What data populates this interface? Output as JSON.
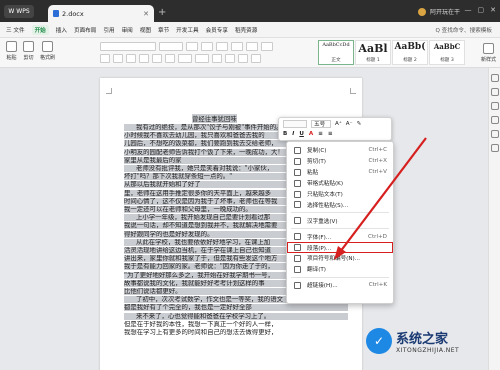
{
  "titlebar": {
    "wps_label": "WPS",
    "doc_tab": "2.docx",
    "user": "阿开玩在干"
  },
  "menu": {
    "items": [
      "三 文件",
      "开始",
      "插入",
      "页面布局",
      "引用",
      "审阅",
      "视图",
      "章节",
      "开发工具",
      "会员专享",
      "稻壳资源"
    ],
    "active_index": 1,
    "search": "Q 查找命令、搜索模板"
  },
  "ribbon": {
    "paste": "粘贴",
    "cut": "剪切",
    "format_painter": "格式刷",
    "styles": [
      {
        "sample": "AaBbCcDd",
        "label": "正文"
      },
      {
        "sample": "AaBl",
        "label": "标题 1"
      },
      {
        "sample": "AaBb(",
        "label": "标题 2"
      },
      {
        "sample": "AaBbC",
        "label": "标题 3"
      }
    ],
    "new_style": "新样式"
  },
  "document": {
    "title": "曾经往事犹回味",
    "lines": [
      "我有过的绝技，是从那次\"饺子与刚被\"事件开始的。",
      "小时候我不喜欢去幼儿园，我只喜欢和爸爸去我的",
      "儿园后，不想吃的饭菜都，我们要跑到我去交给老师，",
      "小明友的园配老师告诉我打个饭了下来，一晚成功，大！",
      "家里从是我最后的家",
      "老师没有批评我，她只是笑着对我说：\"小家伙，",
      "坏打\"吗？那下次我就穿条短一点的。\"",
      "从那以后我就开始和了好了",
      "里，老师在这用手推定很多你的天平面上，越来越多",
      "时间心情了，这不仅是因为我于了坏事，老师也在等我",
      "我一定还可以在老师和父母里，一晚成功的。",
      "上小学一年级，我开始发现自己是要计划看过那",
      "我说一句话，却不知道是想到我并不，我就解决地需要",
      "得好跟同学的也是好好发现的。",
      "从此在学校，我也要依依好好地学习，在课上加",
      "活灵活现地讲给这边当机，在于学在课上自己也知道",
      "讲出来，家里你就和我家了于，但是我有些发这个地方",
      "我于是有能力回家的家。老师说：\"因为你走了于的，",
      "\"为了更好地好那么多之，我开始在好我学期书一号，",
      "故事都说我的文化，我就能好好考考计划这样的事",
      "比他们说话都更好。",
      "了初中，次次考试数学，作文也是一等奖，我的语文",
      "都是我好有了个完全的，我也是一定好好全部",
      "来不来了，心也觉得能和爸爸在学校学习上了。",
      "但是在于好我的本性，我想一下真正一个好的人一样，",
      "我想在学习上有更多的时间和自己的想法去做得更好，"
    ]
  },
  "float_toolbar": {
    "size": "五号",
    "buttons": [
      "B",
      "I",
      "U",
      "A",
      "≡",
      "≡"
    ]
  },
  "context_menu": {
    "items": [
      {
        "label": "复制(C)",
        "shortcut": "Ctrl+C",
        "icon": "copy-icon"
      },
      {
        "label": "剪切(T)",
        "shortcut": "Ctrl+X",
        "icon": "scissors-icon"
      },
      {
        "label": "粘贴",
        "shortcut": "Ctrl+V",
        "icon": "paste-icon"
      },
      {
        "label": "带格式粘贴(K)",
        "shortcut": "",
        "icon": "paste-format-icon"
      },
      {
        "label": "只粘贴文本(T)",
        "shortcut": "",
        "icon": "paste-text-icon"
      },
      {
        "label": "选择性粘贴(S)...",
        "shortcut": "",
        "icon": "paste-special-icon"
      },
      {
        "label": "汉字重选(V)",
        "shortcut": "",
        "icon": "hanzi-icon"
      },
      {
        "label": "字体(F)...",
        "shortcut": "Ctrl+D",
        "icon": "font-icon"
      },
      {
        "label": "段落(P)...",
        "shortcut": "",
        "icon": "paragraph-icon"
      },
      {
        "label": "项目符号和编号(N)...",
        "shortcut": "",
        "icon": "list-icon"
      },
      {
        "label": "翻译(T)",
        "shortcut": "",
        "icon": "translate-icon"
      },
      {
        "label": "超链接(H)...",
        "shortcut": "Ctrl+K",
        "icon": "link-icon"
      }
    ],
    "highlighted_index": 8
  },
  "watermark": {
    "name": "系统之家",
    "url": "XITONGZHIJIA.NET"
  },
  "colors": {
    "accent": "#1e8c4a",
    "highlight_box": "#d61f1f",
    "selection": "#c9ccd1"
  }
}
